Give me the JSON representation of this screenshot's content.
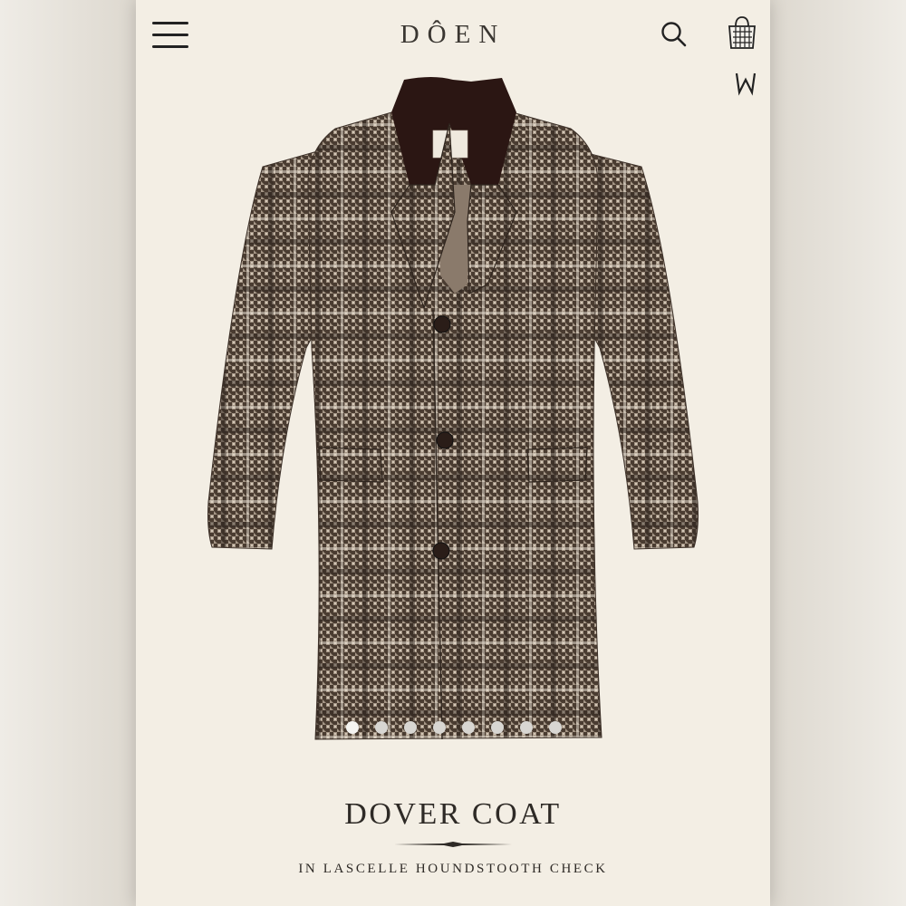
{
  "header": {
    "logo": "DÔEN",
    "icons": [
      "menu-icon",
      "search-icon",
      "shopping-bag-icon",
      "wishlist-icon"
    ]
  },
  "product": {
    "name": "DOVER COAT",
    "subtitle": "IN LASCELLE HOUNDSTOOTH CHECK"
  },
  "carousel": {
    "slide_count": 8,
    "active_index": 0
  },
  "colors": {
    "page_background": "#f3eee4",
    "text": "#2e2a26",
    "coat_fabric": "#857666",
    "collar": "#2b1613"
  }
}
